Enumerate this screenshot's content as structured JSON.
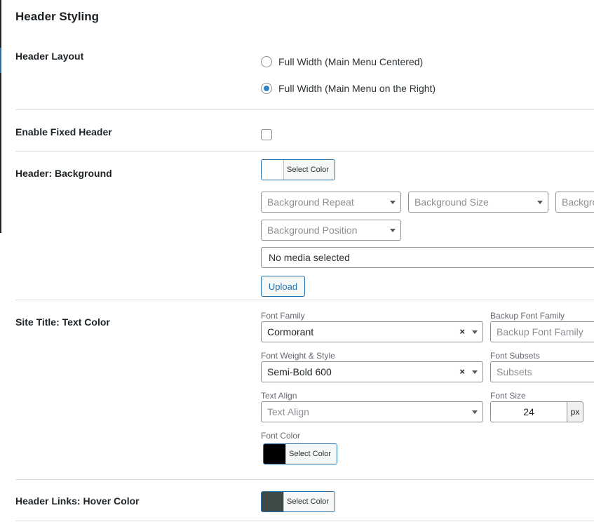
{
  "page": {
    "title": "Header Styling"
  },
  "header_layout": {
    "label": "Header Layout",
    "options": [
      {
        "label": "Full Width (Main Menu Centered)",
        "checked": false
      },
      {
        "label": "Full Width (Main Menu on the Right)",
        "checked": true
      }
    ]
  },
  "fixed_header": {
    "label": "Enable Fixed Header",
    "checked": false
  },
  "header_background": {
    "label": "Header: Background",
    "select_color_label": "Select Color",
    "swatch_color": "#ffffff",
    "repeat_placeholder": "Background Repeat",
    "size_placeholder": "Background Size",
    "attachment_placeholder": "Backgro",
    "position_placeholder": "Background Position",
    "media_text": "No media selected",
    "upload_label": "Upload"
  },
  "site_title": {
    "label": "Site Title: Text Color",
    "font_family_label": "Font Family",
    "font_family_value": "Cormorant",
    "backup_font_label": "Backup Font Family",
    "backup_font_placeholder": "Backup Font Family",
    "font_weight_label": "Font Weight & Style",
    "font_weight_value": "Semi-Bold 600",
    "font_subsets_label": "Font Subsets",
    "font_subsets_placeholder": "Subsets",
    "text_align_label": "Text Align",
    "text_align_placeholder": "Text Align",
    "font_size_label": "Font Size",
    "font_size_value": "24",
    "font_size_unit": "px",
    "font_color_label": "Font Color",
    "select_color_label": "Select Color",
    "swatch_color": "#000000",
    "clear_glyph": "×"
  },
  "header_links": {
    "label": "Header Links: Hover Color",
    "select_color_label": "Select Color",
    "swatch_color": "#3e4a46"
  },
  "colors": {
    "accent": "#2271b1",
    "border": "#8c8f94",
    "divider": "#dcdcde"
  }
}
